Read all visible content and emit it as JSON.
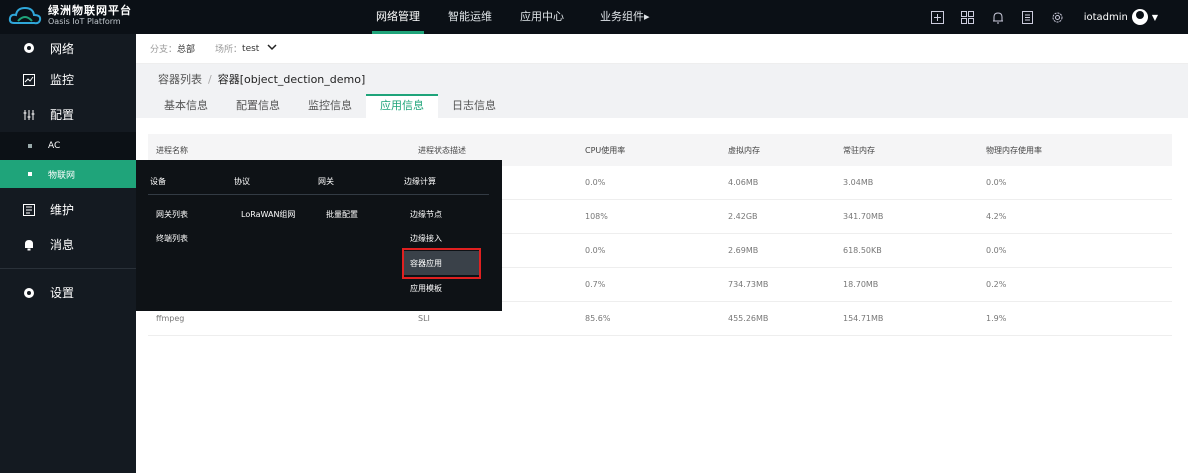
{
  "header": {
    "brand_title": "绿洲物联网平台",
    "brand_subtitle": "Oasis IoT Platform",
    "nav": [
      {
        "label": "网络管理"
      },
      {
        "label": "智能运维"
      },
      {
        "label": "应用中心"
      },
      {
        "label": "业务组件▸"
      }
    ],
    "username": "iotadmin"
  },
  "sidebar": {
    "items": [
      {
        "label": "网络"
      },
      {
        "label": "监控"
      },
      {
        "label": "配置"
      },
      {
        "label": "AC"
      },
      {
        "label": "物联网"
      },
      {
        "label": "维护"
      },
      {
        "label": "消息"
      },
      {
        "label": "设置"
      }
    ]
  },
  "filter": {
    "branch_label": "分支：",
    "branch_value": "总部",
    "site_label": "场所：",
    "site_value": "test"
  },
  "breadcrumb": {
    "parent": "容器列表",
    "separator": "/",
    "current": "容器[object_dection_demo]"
  },
  "tabs": [
    {
      "label": "基本信息"
    },
    {
      "label": "配置信息"
    },
    {
      "label": "监控信息"
    },
    {
      "label": "应用信息"
    },
    {
      "label": "日志信息"
    }
  ],
  "table": {
    "headers": [
      "进程名称",
      "进程状态描述",
      "CPU使用率",
      "虚拟内存",
      "常驻内存",
      "物理内存使用率"
    ],
    "rows": [
      [
        "",
        "",
        "0.0%",
        "4.06MB",
        "3.04MB",
        "0.0%"
      ],
      [
        "",
        "",
        "108%",
        "2.42GB",
        "341.70MB",
        "4.2%"
      ],
      [
        "",
        "",
        "0.0%",
        "2.69MB",
        "618.50KB",
        "0.0%"
      ],
      [
        "",
        "",
        "0.7%",
        "734.73MB",
        "18.70MB",
        "0.2%"
      ],
      [
        "ffmpeg",
        "SLI",
        "85.6%",
        "455.26MB",
        "154.71MB",
        "1.9%"
      ]
    ]
  },
  "dropdown": {
    "headers": [
      "设备",
      "协议",
      "网关",
      "边缘计算"
    ],
    "device_items": [
      "网关列表",
      "终端列表"
    ],
    "protocol_items": [
      "LoRaWAN组网"
    ],
    "gateway_items": [
      "批量配置"
    ],
    "edge_items": [
      "边缘节点",
      "边缘接入",
      "容器应用",
      "应用模板"
    ]
  }
}
